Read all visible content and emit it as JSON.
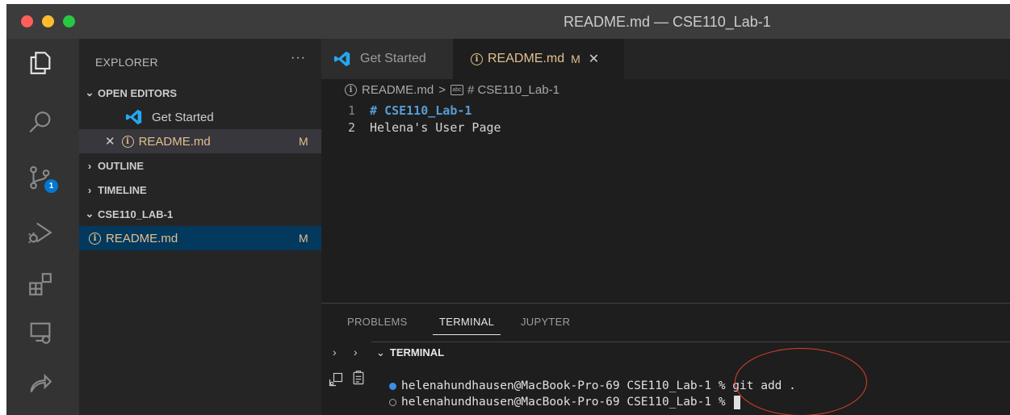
{
  "window": {
    "title": "README.md — CSE110_Lab-1"
  },
  "activity_bar": {
    "items": [
      {
        "name": "explorer-icon"
      },
      {
        "name": "search-icon"
      },
      {
        "name": "source-control-icon",
        "badge": "1"
      },
      {
        "name": "run-debug-icon"
      },
      {
        "name": "extensions-icon"
      },
      {
        "name": "remote-explorer-icon"
      },
      {
        "name": "live-share-icon"
      }
    ]
  },
  "sidebar": {
    "title": "EXPLORER",
    "more": "···",
    "open_editors": {
      "label": "OPEN EDITORS",
      "items": [
        {
          "label": "Get Started"
        },
        {
          "label": "README.md",
          "status": "M"
        }
      ]
    },
    "outline": "OUTLINE",
    "timeline": "TIMELINE",
    "folder": {
      "label": "CSE110_LAB-1",
      "files": [
        {
          "label": "README.md",
          "status": "M"
        }
      ]
    }
  },
  "tabs": [
    {
      "label": "Get Started",
      "active": false
    },
    {
      "label": "README.md",
      "status": "M",
      "active": true
    }
  ],
  "breadcrumb": {
    "file": "README.md",
    "sep": ">",
    "symbol": "# CSE110_Lab-1",
    "symbol_icon": "abc"
  },
  "editor": {
    "lines": [
      {
        "number": "1",
        "prefix": "# ",
        "text": "CSE110_Lab-1"
      },
      {
        "number": "2",
        "prefix": "",
        "text": "Helena's User Page"
      }
    ]
  },
  "panel": {
    "tabs": [
      "PROBLEMS",
      "TERMINAL",
      "JUPYTER"
    ],
    "active_tab": "TERMINAL",
    "section_title": "TERMINAL",
    "terminal_lines": [
      {
        "status": "success",
        "text": "helenahundhausen@MacBook-Pro-69 CSE110_Lab-1 % git add ."
      },
      {
        "status": "pending",
        "text": "helenahundhausen@MacBook-Pro-69 CSE110_Lab-1 % "
      }
    ]
  },
  "colors": {
    "modified": "#e2c08d",
    "accent": "#0078d4",
    "annotation": "#e0402a"
  }
}
